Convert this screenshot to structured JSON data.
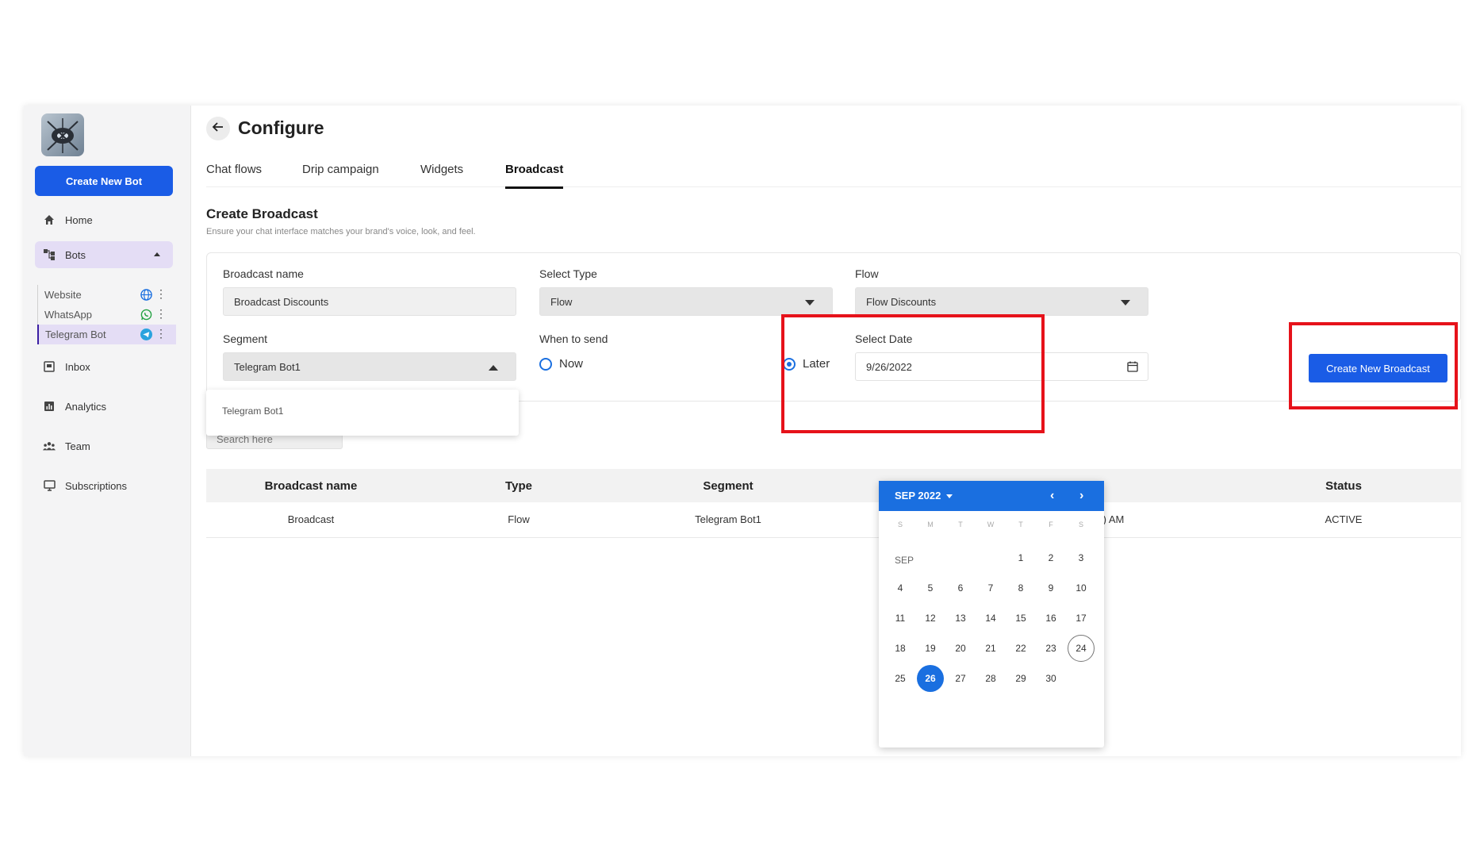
{
  "sidebar": {
    "create_bot_label": "Create New Bot",
    "nav": [
      {
        "label": "Home",
        "icon": "home-icon"
      },
      {
        "label": "Bots",
        "icon": "bots-icon"
      },
      {
        "label": "Inbox",
        "icon": "inbox-icon"
      },
      {
        "label": "Analytics",
        "icon": "analytics-icon"
      },
      {
        "label": "Team",
        "icon": "team-icon"
      },
      {
        "label": "Subscriptions",
        "icon": "subscriptions-icon"
      }
    ],
    "bots": [
      {
        "label": "Website",
        "icon": "globe-icon"
      },
      {
        "label": "WhatsApp",
        "icon": "whatsapp-icon"
      },
      {
        "label": "Telegram Bot",
        "icon": "telegram-icon"
      }
    ]
  },
  "header": {
    "title": "Configure"
  },
  "tabs": [
    "Chat flows",
    "Drip campaign",
    "Widgets",
    "Broadcast"
  ],
  "active_tab": "Broadcast",
  "section": {
    "title": "Create Broadcast",
    "subtitle": "Ensure your chat interface matches your brand's voice, look, and feel."
  },
  "form": {
    "broadcast_name_label": "Broadcast name",
    "broadcast_name_value": "Broadcast Discounts",
    "select_type_label": "Select Type",
    "select_type_value": "Flow",
    "flow_label": "Flow",
    "flow_value": "Flow Discounts",
    "segment_label": "Segment",
    "segment_value": "Telegram Bot1",
    "segment_options": [
      "Telegram Bot1"
    ],
    "when_label": "When to send",
    "now_label": "Now",
    "later_label": "Later",
    "selected_when": "Later",
    "select_date_label": "Select Date",
    "select_date_value": "9/26/2022",
    "create_button": "Create New Broadcast"
  },
  "search": {
    "placeholder": "Search here"
  },
  "table": {
    "headers": [
      "Broadcast name",
      "Type",
      "Segment",
      "Status"
    ],
    "rows": [
      {
        "name": "Broadcast",
        "type": "Flow",
        "segment": "Telegram Bot1",
        "time_fragment": ") AM",
        "status": "ACTIVE"
      }
    ]
  },
  "calendar": {
    "month_label": "SEP 2022",
    "month_short": "SEP",
    "weekdays": [
      "S",
      "M",
      "T",
      "W",
      "T",
      "F",
      "S"
    ],
    "weeks": [
      [
        "",
        "",
        "",
        "",
        "1",
        "2",
        "3"
      ],
      [
        "4",
        "5",
        "6",
        "7",
        "8",
        "9",
        "10"
      ],
      [
        "11",
        "12",
        "13",
        "14",
        "15",
        "16",
        "17"
      ],
      [
        "18",
        "19",
        "20",
        "21",
        "22",
        "23",
        "24"
      ],
      [
        "25",
        "26",
        "27",
        "28",
        "29",
        "30",
        ""
      ]
    ],
    "selected_day": "26",
    "today_day": "24"
  },
  "colors": {
    "primary": "#1a5ce6",
    "highlight_box": "#e6121a",
    "sidebar_active": "#e4ddf5"
  }
}
